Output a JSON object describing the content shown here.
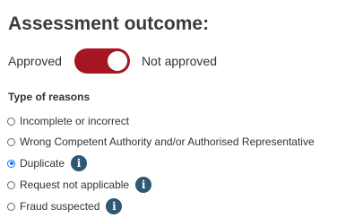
{
  "title": "Assessment outcome:",
  "outcome_toggle": {
    "left_label": "Approved",
    "right_label": "Not approved",
    "state": "on",
    "track_color": "#a31622"
  },
  "reasons": {
    "heading": "Type of reasons",
    "options": [
      {
        "label": "Incomplete or incorrect",
        "selected": false,
        "has_info": false
      },
      {
        "label": "Wrong Competent Authority and/or Authorised Representative",
        "selected": false,
        "has_info": false
      },
      {
        "label": "Duplicate",
        "selected": true,
        "has_info": true
      },
      {
        "label": "Request not applicable",
        "selected": false,
        "has_info": true
      },
      {
        "label": "Fraud suspected",
        "selected": false,
        "has_info": true
      }
    ],
    "info_icon_glyph": "i",
    "info_icon_color": "#2e5873"
  },
  "colors": {
    "radio_selected": "#1a73e8"
  }
}
